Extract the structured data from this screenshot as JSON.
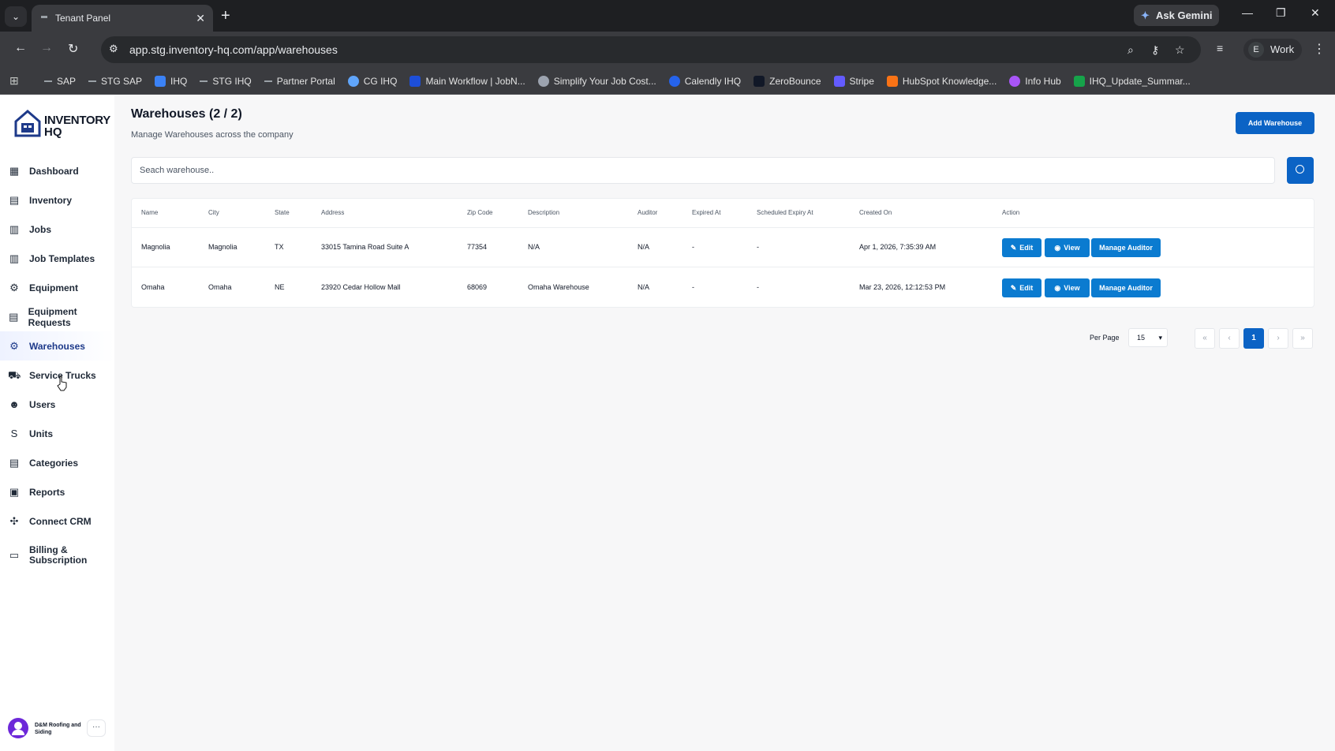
{
  "browser": {
    "tab_title": "Tenant Panel",
    "tab_close": "✕",
    "new_tab": "+",
    "ask_gemini": "Ask Gemini",
    "url": "app.stg.inventory-hq.com/app/warehouses",
    "profile_initial": "E",
    "profile_label": "Work",
    "bookmarks": [
      {
        "label": "SAP",
        "icon": "dash"
      },
      {
        "label": "STG SAP",
        "icon": "dash"
      },
      {
        "label": "IHQ",
        "icon": "house",
        "color": "#3b82f6"
      },
      {
        "label": "STG IHQ",
        "icon": "dash"
      },
      {
        "label": "Partner Portal",
        "icon": "dash"
      },
      {
        "label": "CG IHQ",
        "icon": "circle",
        "color": "#60a5fa"
      },
      {
        "label": "Main Workflow | JobN...",
        "icon": "square",
        "color": "#1d4ed8"
      },
      {
        "label": "Simplify Your Job Cost...",
        "icon": "circle",
        "color": "#9ca3af"
      },
      {
        "label": "Calendly IHQ",
        "icon": "circle",
        "color": "#2563eb"
      },
      {
        "label": "ZeroBounce",
        "icon": "square",
        "color": "#111827"
      },
      {
        "label": "Stripe",
        "icon": "square",
        "color": "#635bff"
      },
      {
        "label": "HubSpot Knowledge...",
        "icon": "square",
        "color": "#f97316"
      },
      {
        "label": "Info Hub",
        "icon": "circle",
        "color": "#a855f7"
      },
      {
        "label": "IHQ_Update_Summar...",
        "icon": "square",
        "color": "#16a34a"
      }
    ]
  },
  "logo": {
    "line1": "INVENTORY",
    "line2": "HQ"
  },
  "sidebar": {
    "items": [
      {
        "label": "Dashboard",
        "icon": "grid-icon",
        "glyph": "▦"
      },
      {
        "label": "Inventory",
        "icon": "boxes-icon",
        "glyph": "▤"
      },
      {
        "label": "Jobs",
        "icon": "briefcase-icon",
        "glyph": "▥"
      },
      {
        "label": "Job Templates",
        "icon": "template-icon",
        "glyph": "▥"
      },
      {
        "label": "Equipment",
        "icon": "wrench-gear-icon",
        "glyph": "⚙"
      },
      {
        "label": "Equipment Requests",
        "icon": "request-list-icon",
        "glyph": "▤"
      },
      {
        "label": "Warehouses",
        "icon": "warehouse-gear-icon",
        "glyph": "⚙",
        "active": true
      },
      {
        "label": "Service Trucks",
        "icon": "truck-icon",
        "glyph": "⛟"
      },
      {
        "label": "Users",
        "icon": "users-icon",
        "glyph": "☻"
      },
      {
        "label": "Units",
        "icon": "units-icon",
        "glyph": "S"
      },
      {
        "label": "Categories",
        "icon": "categories-icon",
        "glyph": "▤"
      },
      {
        "label": "Reports",
        "icon": "reports-icon",
        "glyph": "▣"
      },
      {
        "label": "Connect CRM",
        "icon": "crm-icon",
        "glyph": "✣"
      },
      {
        "label": "Billing & Subscription",
        "icon": "credit-card-icon",
        "glyph": "▭"
      }
    ]
  },
  "org": {
    "name": "D&M Roofing and Siding",
    "more": "···"
  },
  "page": {
    "title": "Warehouses (2 / 2)",
    "subtitle": "Manage Warehouses across the company",
    "add_button": "Add Warehouse",
    "search_placeholder": "Seach warehouse.."
  },
  "table": {
    "columns": [
      "Name",
      "City",
      "State",
      "Address",
      "Zip Code",
      "Description",
      "Auditor",
      "Expired At",
      "Scheduled Expiry At",
      "Created On",
      "Action"
    ],
    "rows": [
      {
        "name": "Magnolia",
        "city": "Magnolia",
        "state": "TX",
        "address": "33015 Tamina Road Suite A",
        "zip": "77354",
        "description": "N/A",
        "auditor": "N/A",
        "expired_at": "-",
        "scheduled_expiry_at": "-",
        "created_on": "Apr 1, 2026, 7:35:39 AM"
      },
      {
        "name": "Omaha",
        "city": "Omaha",
        "state": "NE",
        "address": "23920 Cedar Hollow Mall",
        "zip": "68069",
        "description": "Omaha Warehouse",
        "auditor": "N/A",
        "expired_at": "-",
        "scheduled_expiry_at": "-",
        "created_on": "Mar 23, 2026, 12:12:53 PM"
      }
    ],
    "actions": {
      "edit": "Edit",
      "view": "View",
      "manage_auditor": "Manage Auditor"
    }
  },
  "pagination": {
    "per_page_label": "Per Page",
    "per_page_value": "15",
    "first": "«",
    "prev": "‹",
    "current_page": "1",
    "next": "›",
    "last": "»"
  },
  "colors": {
    "primary": "#0b63c5",
    "action": "#0b7bd0",
    "active_nav": "#1e3a8a"
  }
}
